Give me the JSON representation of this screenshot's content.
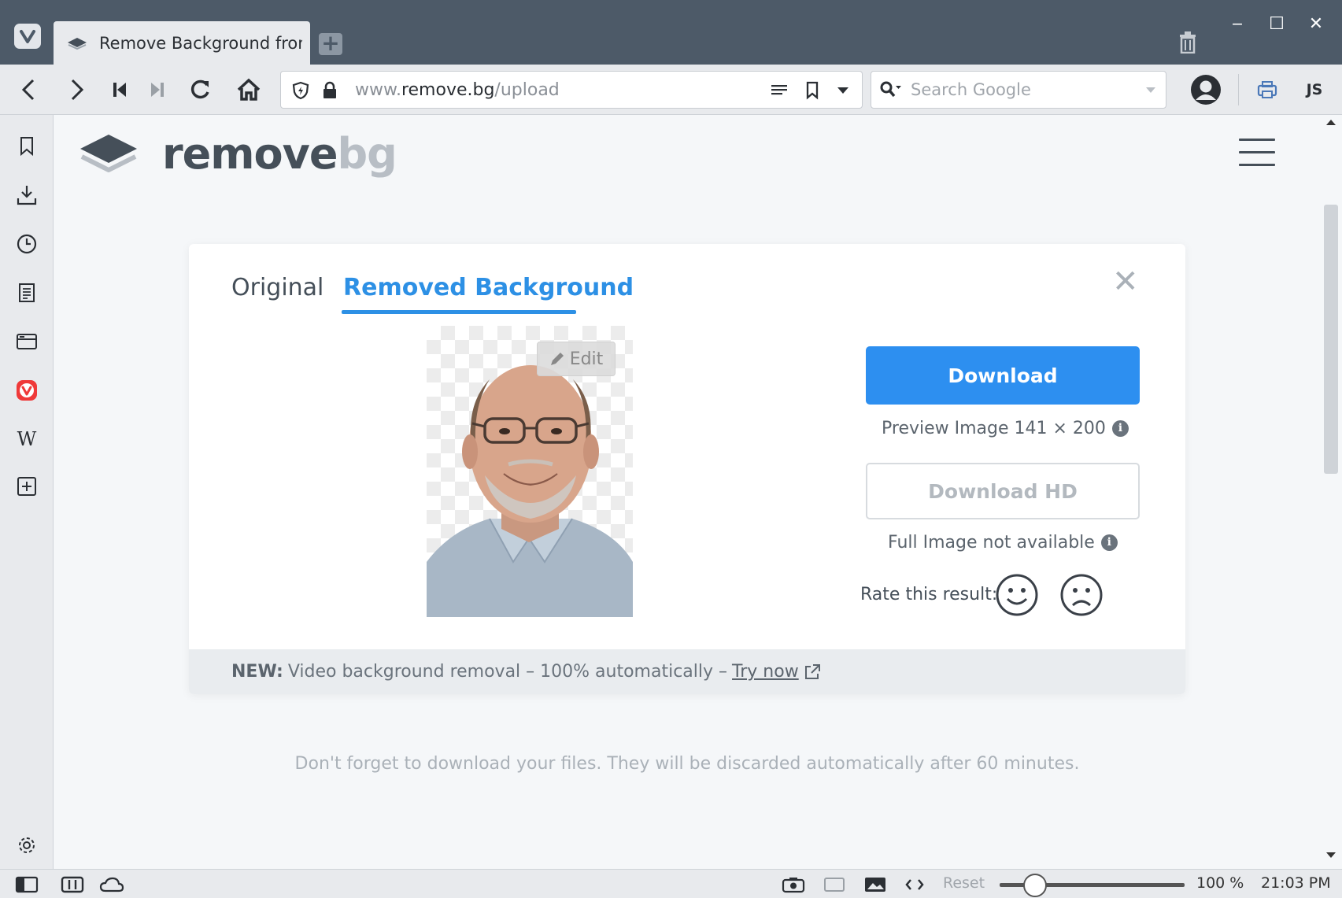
{
  "window": {
    "tab_title": "Remove Background from",
    "new_tab_symbol": "+",
    "controls": {
      "minimize": "‒",
      "maximize": "☐",
      "close": "✕"
    }
  },
  "toolbar": {
    "url_host_prefix": "www.",
    "url_domain": "remove.bg",
    "url_path": "/upload",
    "search_placeholder": "Search Google",
    "js_label": "JS"
  },
  "site": {
    "logo_remove": "remove",
    "logo_bg": "bg",
    "tabs": {
      "original": "Original",
      "removed": "Removed Background"
    },
    "close_symbol": "✕",
    "edit_label": "Edit",
    "download_label": "Download",
    "preview_info": "Preview Image 141 × 200",
    "download_hd_label": "Download HD",
    "full_image_info": "Full Image not available",
    "info_symbol": "i",
    "rate_label": "Rate this result:",
    "promo_strong": "NEW:",
    "promo_text": "Video background removal – 100% automatically –",
    "promo_link": "Try now",
    "discard_note": "Don't forget to download your files. They will be discarded automatically after 60 minutes.",
    "brand_blue": "#2d8ff0"
  },
  "statusbar": {
    "reset_label": "Reset",
    "zoom": "100 %",
    "time": "21:03 PM"
  }
}
